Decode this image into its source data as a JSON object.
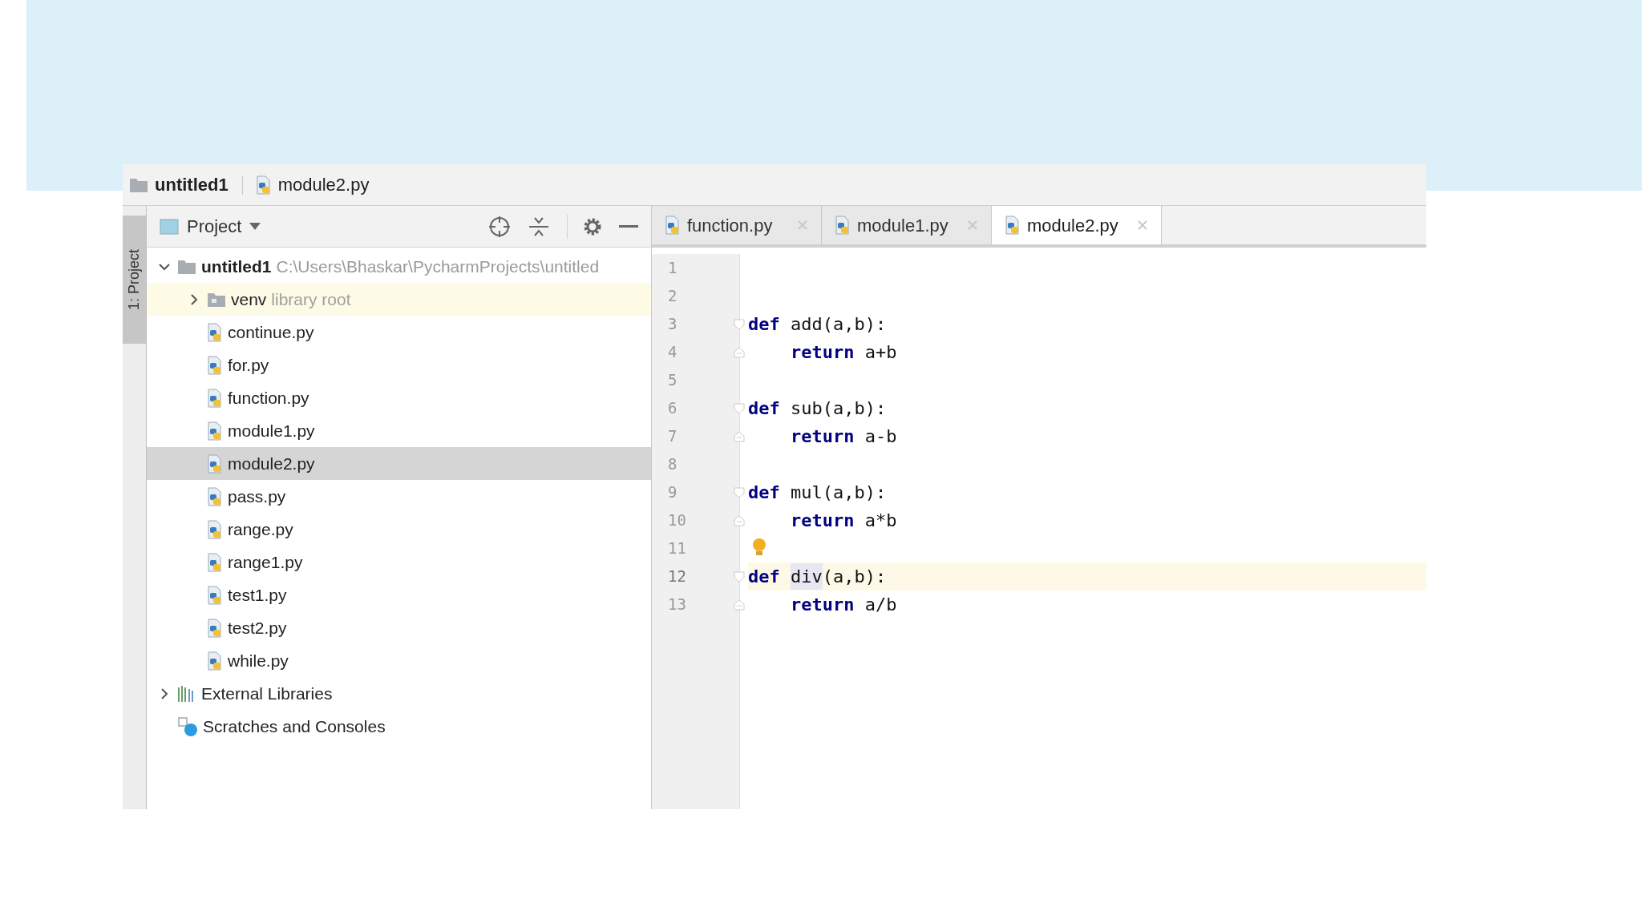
{
  "breadcrumb": [
    {
      "kind": "folder",
      "label": "untitled1"
    },
    {
      "kind": "python-file",
      "label": "module2.py"
    }
  ],
  "side_tab": {
    "label": "1: Project",
    "selected": true
  },
  "project_panel": {
    "title": "Project"
  },
  "tree": [
    {
      "kind": "folder",
      "name": "untitled1",
      "path": "C:\\Users\\Bhaskar\\PycharmProjects\\untitled",
      "expanded": true,
      "selected": false,
      "children": [
        {
          "kind": "library-folder",
          "name": "venv",
          "hint": "library root",
          "expanded": false,
          "selected": false
        },
        {
          "kind": "python-file",
          "name": "continue.py",
          "selected": false
        },
        {
          "kind": "python-file",
          "name": "for.py",
          "selected": false
        },
        {
          "kind": "python-file",
          "name": "function.py",
          "selected": false
        },
        {
          "kind": "python-file",
          "name": "module1.py",
          "selected": false
        },
        {
          "kind": "python-file",
          "name": "module2.py",
          "selected": true
        },
        {
          "kind": "python-file",
          "name": "pass.py",
          "selected": false
        },
        {
          "kind": "python-file",
          "name": "range.py",
          "selected": false
        },
        {
          "kind": "python-file",
          "name": "range1.py",
          "selected": false
        },
        {
          "kind": "python-file",
          "name": "test1.py",
          "selected": false
        },
        {
          "kind": "python-file",
          "name": "test2.py",
          "selected": false
        },
        {
          "kind": "python-file",
          "name": "while.py",
          "selected": false
        }
      ]
    },
    {
      "kind": "libraries",
      "name": "External Libraries",
      "expanded": false,
      "selected": false
    },
    {
      "kind": "scratches",
      "name": "Scratches and Consoles",
      "selected": false
    }
  ],
  "tabs": [
    {
      "label": "function.py",
      "selected": false
    },
    {
      "label": "module1.py",
      "selected": false
    },
    {
      "label": "module2.py",
      "selected": true
    }
  ],
  "editor": {
    "lines": [
      {
        "number": "1",
        "kind": "blank",
        "current": false
      },
      {
        "number": "2",
        "kind": "blank",
        "current": false
      },
      {
        "number": "3",
        "kind": "def",
        "current": false,
        "segments": [
          {
            "kind": "keyword",
            "text": "def"
          },
          {
            "kind": "plain",
            "text": " add(a,b):"
          }
        ]
      },
      {
        "number": "4",
        "kind": "body",
        "current": false,
        "segments": [
          {
            "kind": "keyword",
            "text": "return"
          },
          {
            "kind": "plain",
            "text": " a+b"
          }
        ]
      },
      {
        "number": "5",
        "kind": "blank",
        "current": false
      },
      {
        "number": "6",
        "kind": "def",
        "current": false,
        "segments": [
          {
            "kind": "keyword",
            "text": "def"
          },
          {
            "kind": "plain",
            "text": " sub(a,b):"
          }
        ]
      },
      {
        "number": "7",
        "kind": "body",
        "current": false,
        "segments": [
          {
            "kind": "keyword",
            "text": "return"
          },
          {
            "kind": "plain",
            "text": " a-b"
          }
        ]
      },
      {
        "number": "8",
        "kind": "blank",
        "current": false
      },
      {
        "number": "9",
        "kind": "def",
        "current": false,
        "segments": [
          {
            "kind": "keyword",
            "text": "def"
          },
          {
            "kind": "plain",
            "text": " mul(a,b):"
          }
        ]
      },
      {
        "number": "10",
        "kind": "body",
        "current": false,
        "segments": [
          {
            "kind": "keyword",
            "text": "return"
          },
          {
            "kind": "plain",
            "text": " a*b"
          }
        ]
      },
      {
        "number": "11",
        "kind": "bulb",
        "current": false
      },
      {
        "number": "12",
        "kind": "def",
        "current": true,
        "segments": [
          {
            "kind": "keyword",
            "text": "def "
          },
          {
            "kind": "highlight",
            "text": "div"
          },
          {
            "kind": "plain",
            "text": "(a,b):"
          }
        ]
      },
      {
        "number": "13",
        "kind": "body",
        "current": false,
        "segments": [
          {
            "kind": "keyword",
            "text": "return"
          },
          {
            "kind": "plain",
            "text": " a/b"
          }
        ]
      }
    ]
  }
}
